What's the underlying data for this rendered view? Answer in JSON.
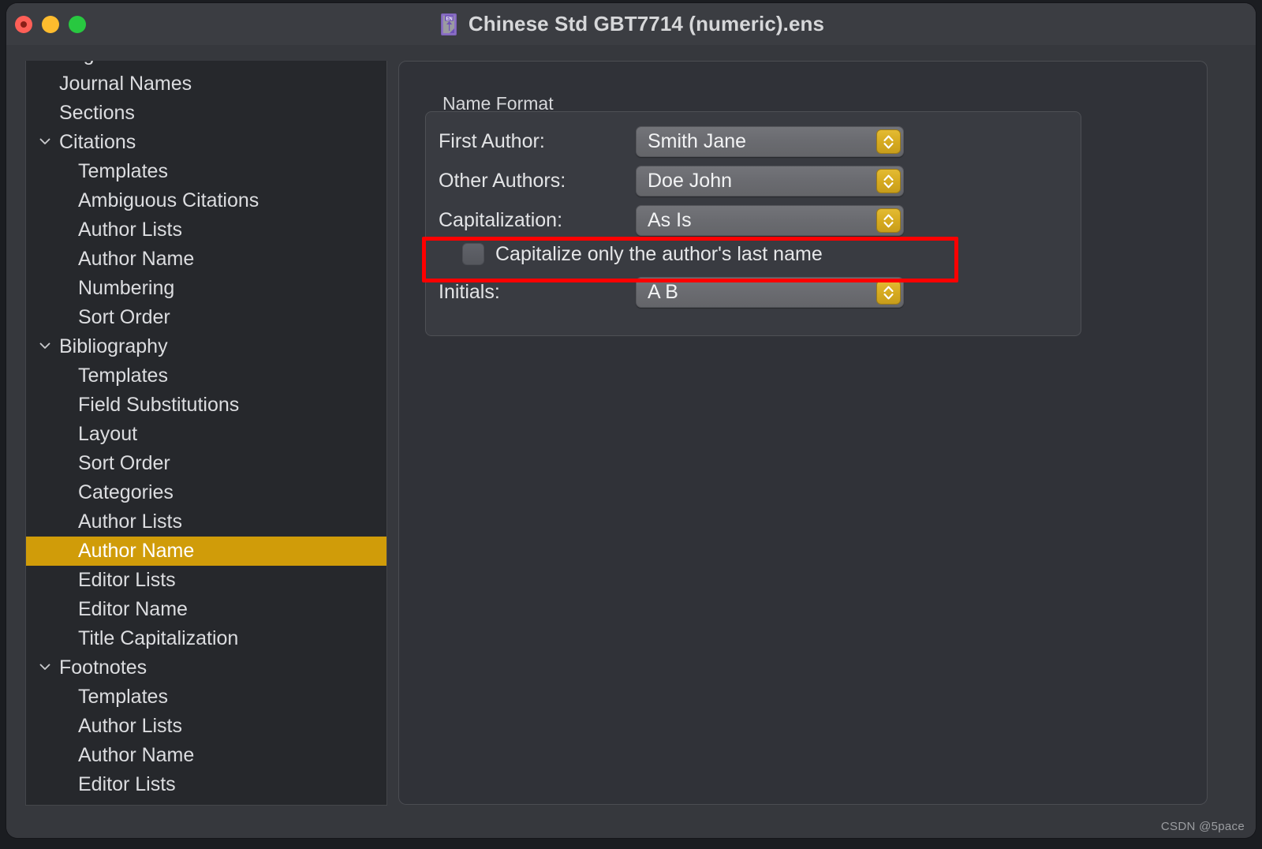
{
  "window": {
    "title": "Chinese Std GBT7714 (numeric).ens",
    "doc_icon": "endnote-style-document-icon",
    "icon_badge_text": "EN",
    "traffic_lights": [
      {
        "name": "close",
        "color": "#ff5f57"
      },
      {
        "name": "minimize",
        "color": "#febc2e"
      },
      {
        "name": "maximize",
        "color": "#28c840"
      }
    ]
  },
  "sidebar": {
    "items": [
      {
        "label": "Page Numbers",
        "level": 0,
        "twisty": "none",
        "selected": false,
        "partial": true
      },
      {
        "label": "Journal Names",
        "level": 0,
        "twisty": "none",
        "selected": false
      },
      {
        "label": "Sections",
        "level": 0,
        "twisty": "none",
        "selected": false
      },
      {
        "label": "Citations",
        "level": 0,
        "twisty": "chevron-down-icon",
        "selected": false
      },
      {
        "label": "Templates",
        "level": 1,
        "twisty": "none",
        "selected": false
      },
      {
        "label": "Ambiguous Citations",
        "level": 1,
        "twisty": "none",
        "selected": false
      },
      {
        "label": "Author Lists",
        "level": 1,
        "twisty": "none",
        "selected": false
      },
      {
        "label": "Author Name",
        "level": 1,
        "twisty": "none",
        "selected": false
      },
      {
        "label": "Numbering",
        "level": 1,
        "twisty": "none",
        "selected": false
      },
      {
        "label": "Sort Order",
        "level": 1,
        "twisty": "none",
        "selected": false
      },
      {
        "label": "Bibliography",
        "level": 0,
        "twisty": "chevron-down-icon",
        "selected": false
      },
      {
        "label": "Templates",
        "level": 1,
        "twisty": "none",
        "selected": false
      },
      {
        "label": "Field Substitutions",
        "level": 1,
        "twisty": "none",
        "selected": false
      },
      {
        "label": "Layout",
        "level": 1,
        "twisty": "none",
        "selected": false
      },
      {
        "label": "Sort Order",
        "level": 1,
        "twisty": "none",
        "selected": false
      },
      {
        "label": "Categories",
        "level": 1,
        "twisty": "none",
        "selected": false
      },
      {
        "label": "Author Lists",
        "level": 1,
        "twisty": "none",
        "selected": false
      },
      {
        "label": "Author Name",
        "level": 1,
        "twisty": "none",
        "selected": true
      },
      {
        "label": "Editor Lists",
        "level": 1,
        "twisty": "none",
        "selected": false
      },
      {
        "label": "Editor Name",
        "level": 1,
        "twisty": "none",
        "selected": false
      },
      {
        "label": "Title Capitalization",
        "level": 1,
        "twisty": "none",
        "selected": false
      },
      {
        "label": "Footnotes",
        "level": 0,
        "twisty": "chevron-down-icon",
        "selected": false
      },
      {
        "label": "Templates",
        "level": 1,
        "twisty": "none",
        "selected": false
      },
      {
        "label": "Author Lists",
        "level": 1,
        "twisty": "none",
        "selected": false
      },
      {
        "label": "Author Name",
        "level": 1,
        "twisty": "none",
        "selected": false
      },
      {
        "label": "Editor Lists",
        "level": 1,
        "twisty": "none",
        "selected": false
      }
    ],
    "selection_color": "#d09c09"
  },
  "main": {
    "group_title": "Name Format",
    "fields": [
      {
        "label": "First Author:",
        "value": "Smith Jane",
        "control": "popup-menu",
        "highlighted": false
      },
      {
        "label": "Other Authors:",
        "value": "Doe John",
        "control": "popup-menu",
        "highlighted": false
      },
      {
        "label": "Capitalization:",
        "value": "As Is",
        "control": "popup-menu",
        "highlighted": true
      },
      {
        "label": "Initials:",
        "value": "A B",
        "control": "popup-menu",
        "highlighted": false
      }
    ],
    "checkbox": {
      "label": "Capitalize only the author's last name",
      "checked": false
    },
    "annotation": {
      "type": "red-rectangle",
      "color": "#fe0000",
      "targets": "Capitalization: As Is"
    }
  },
  "watermark": {
    "text": "CSDN @5pace"
  }
}
